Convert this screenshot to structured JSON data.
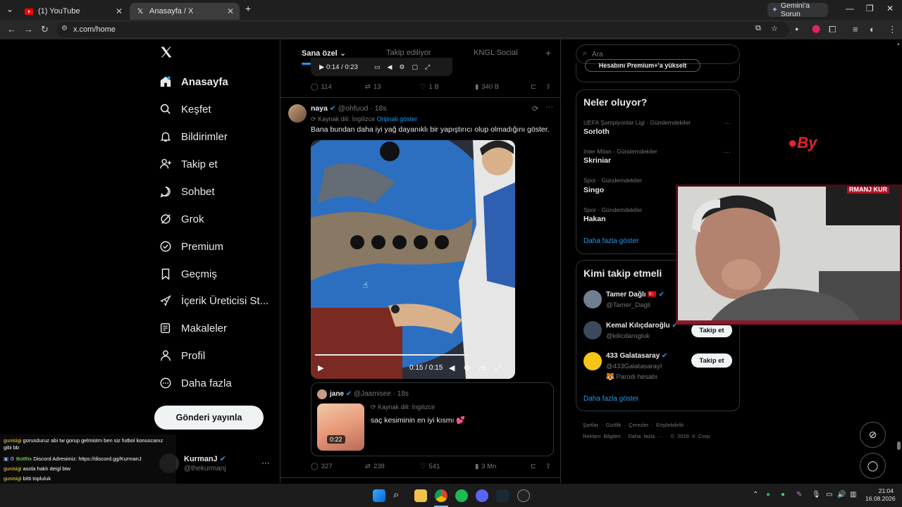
{
  "browser": {
    "tabs": [
      {
        "title": "(1) YouTube",
        "active": false
      },
      {
        "title": "Anasayfa / X",
        "active": true
      }
    ],
    "gemini_label": "Gemini'a Sorun",
    "url": "x.com/home"
  },
  "nav": {
    "items": [
      {
        "label": "Anasayfa",
        "icon": "home-icon"
      },
      {
        "label": "Keşfet",
        "icon": "search-icon"
      },
      {
        "label": "Bildirimler",
        "icon": "bell-icon"
      },
      {
        "label": "Takip et",
        "icon": "person-add-icon"
      },
      {
        "label": "Sohbet",
        "icon": "chat-icon"
      },
      {
        "label": "Grok",
        "icon": "grok-icon"
      },
      {
        "label": "Premium",
        "icon": "premium-icon"
      },
      {
        "label": "Geçmiş",
        "icon": "bookmark-icon"
      },
      {
        "label": "İçerik Üreticisi St...",
        "icon": "rocket-icon"
      },
      {
        "label": "Makaleler",
        "icon": "article-icon"
      },
      {
        "label": "Profil",
        "icon": "profile-icon"
      },
      {
        "label": "Daha fazla",
        "icon": "more-circle-icon"
      }
    ],
    "post_button": "Gönderi yayınla"
  },
  "account": {
    "name": "KurmanJ",
    "handle": "@thekurmanj"
  },
  "feed": {
    "tabs": [
      "Sana özel",
      "Takip ediliyor",
      "KNGL Social"
    ],
    "prev_post": {
      "time": "0:14 / 0:23",
      "replies": "114",
      "reposts": "13",
      "likes": "1 B",
      "views": "340 B"
    },
    "post": {
      "author": "naya",
      "handle": "@ohfuud",
      "age": "18s",
      "source_lang": "Kaynak dili: İngilizce",
      "show_original": "Orijinali göster",
      "text": "Bana bundan daha iyi yağ dayanıklı bir yapıştırıcı olup olmadığını göster.",
      "video_time": "0:15 / 0:15",
      "replies": "327",
      "reposts": "238",
      "likes": "541",
      "views": "3 Mn"
    },
    "quote": {
      "author": "jane",
      "handle": "@Jaamisee",
      "age": "18s",
      "source_lang": "Kaynak dili: İngilizce",
      "text": "saç kesiminin en iyi kısmı 💕",
      "duration": "0:22"
    }
  },
  "search": {
    "placeholder": "Ara"
  },
  "premium_banner": "Hesabını Premium+'a yükselt",
  "trends": {
    "title": "Neler oluyor?",
    "items": [
      {
        "meta": "UEFA Şampiyonlar Ligi · Gündemdekiler",
        "name": "Sorloth"
      },
      {
        "meta": "Inter Milan · Gündemdekiler",
        "name": "Skriniar"
      },
      {
        "meta": "Spor · Gündemdekiler",
        "name": "Singo"
      },
      {
        "meta": "Spor · Gündemdekiler",
        "name": "Hakan"
      }
    ],
    "show_more": "Daha fazla göster"
  },
  "who_to_follow": {
    "title": "Kimi takip etmeli",
    "items": [
      {
        "name": "Tamer Dağlı 🇹🇷",
        "handle": "@Tamer_Dagli",
        "button": ""
      },
      {
        "name": "Kemal Kılıçdaroğlu",
        "handle": "@kilicdarogluk",
        "button": "Takip et"
      },
      {
        "name": "433 Galatasaray",
        "handle": "@433GalatasarayI",
        "note": "🐯 Parodi hesabı",
        "button": "Takip et"
      }
    ],
    "show_more": "Daha fazla göster"
  },
  "footer": {
    "line1": [
      "Şartlar",
      "Gizlilik",
      "Çerezler",
      "Erişilebilirlik"
    ],
    "line2": [
      "Reklam Bilgileri",
      "Daha fazla ···",
      "© 2026 X Corp."
    ]
  },
  "stream": {
    "banner": "RMANJ  KUR",
    "chat": [
      {
        "user": "gunisigi",
        "text": "gorusduruz abi tw gorup gelmistm ben siz futbol konuscanız gibi bb"
      },
      {
        "user": "BotRix",
        "text": "Discord Adresimiz: https://discord.gg/KurmanJ"
      },
      {
        "user": "gunisigi",
        "text": "asola haklı deigl btw"
      },
      {
        "user": "gunisigi",
        "text": "bitti topluluk"
      }
    ]
  },
  "clock": {
    "time": "21:04",
    "date": "16.08.2026"
  },
  "colors": {
    "accent": "#1d9bf0",
    "follow_bg": "#eff3f4",
    "border": "#2f3336",
    "muted": "#71767b"
  }
}
